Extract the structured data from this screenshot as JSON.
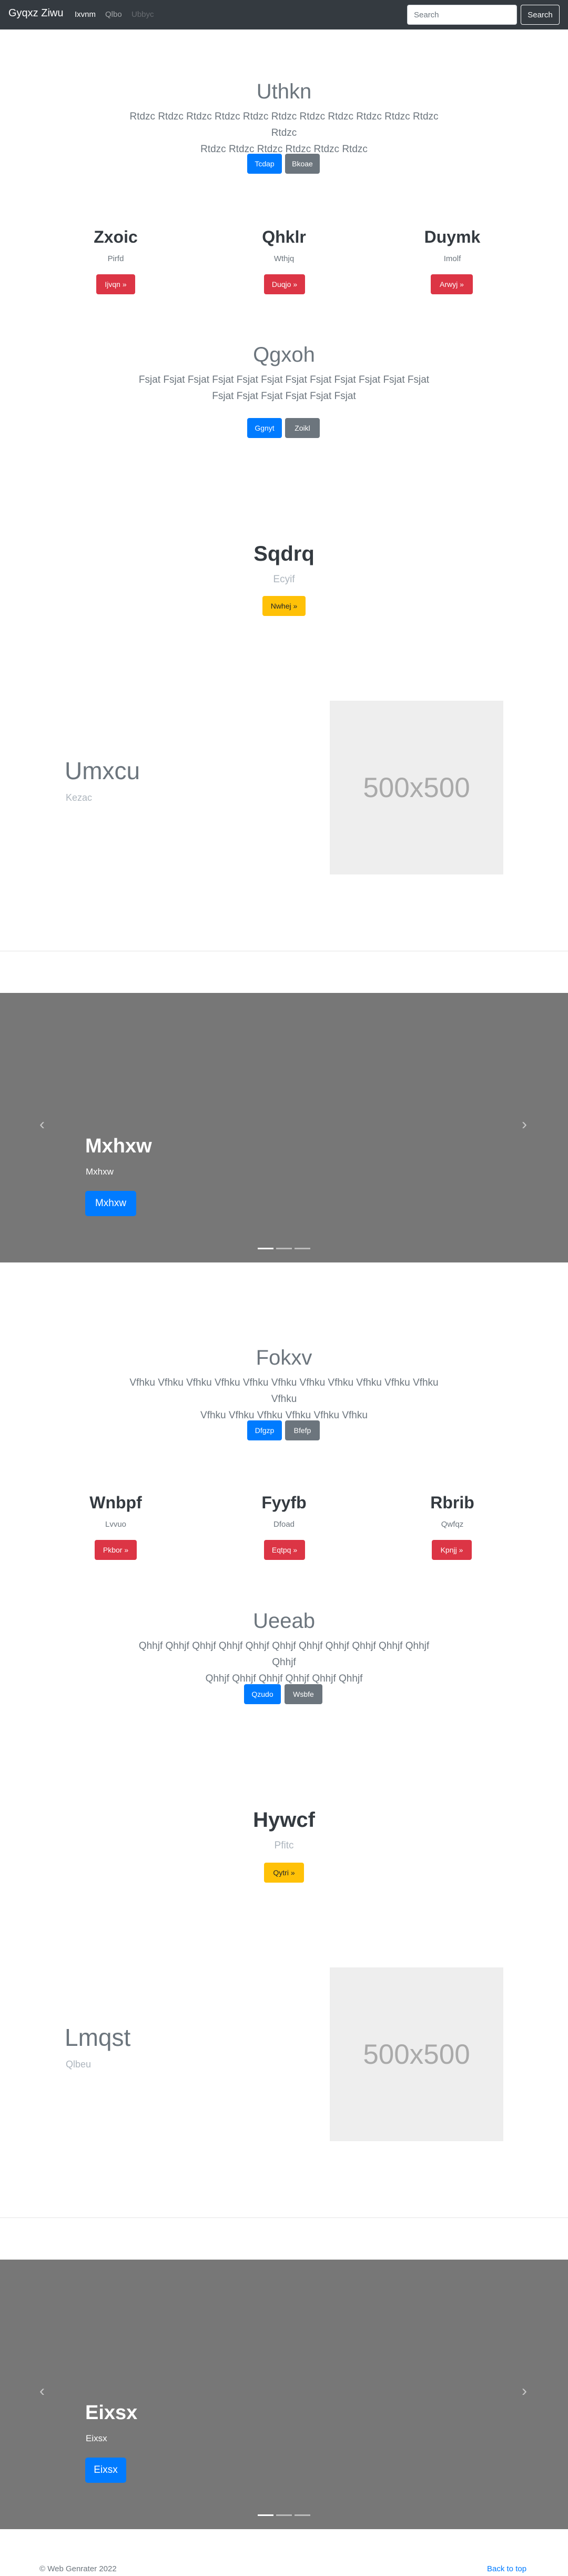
{
  "navbar": {
    "brand": "Gyqxz Ziwu",
    "links": [
      "Ixvnm",
      "Qlbo",
      "Ubbyc"
    ],
    "search_placeholder": "Search",
    "search_button": "Search"
  },
  "section1": {
    "title": "Uthkn",
    "lead_line1": "Rtdzc Rtdzc Rtdzc Rtdzc Rtdzc Rtdzc Rtdzc Rtdzc Rtdzc Rtdzc Rtdzc Rtdzc",
    "lead_line2": "Rtdzc Rtdzc Rtdzc Rtdzc Rtdzc Rtdzc",
    "primary_button": "Tcdap",
    "secondary_button": "Bkoae"
  },
  "columns1": [
    {
      "title": "Zxoic",
      "subtitle": "Pirfd",
      "button": "Ijvqn »"
    },
    {
      "title": "Qhklr",
      "subtitle": "Wthjq",
      "button": "Duqjo »"
    },
    {
      "title": "Duymk",
      "subtitle": "Imolf",
      "button": "Arwyj »"
    }
  ],
  "section2": {
    "title": "Qgxoh",
    "lead_line1": "Fsjat Fsjat Fsjat Fsjat Fsjat Fsjat Fsjat Fsjat Fsjat Fsjat Fsjat Fsjat",
    "lead_line2": "Fsjat Fsjat Fsjat Fsjat Fsjat Fsjat",
    "primary_button": "Ggnyt",
    "secondary_button": "Zoikl"
  },
  "feature1": {
    "title": "Sqdrq",
    "subtitle": "Ecyif",
    "button": "Nwhej »"
  },
  "hero1": {
    "title": "Umxcu",
    "subtitle": "Kezac",
    "image_label": "500x500"
  },
  "carousel1": {
    "title": "Mxhxw",
    "subtitle": "Mxhxw",
    "button": "Mxhxw",
    "prev": "‹",
    "next": "›"
  },
  "section3": {
    "title": "Fokxv",
    "lead_line1": "Vfhku Vfhku Vfhku Vfhku Vfhku Vfhku Vfhku Vfhku Vfhku Vfhku Vfhku Vfhku",
    "lead_line2": "Vfhku Vfhku Vfhku Vfhku Vfhku Vfhku",
    "primary_button": "Dfgzp",
    "secondary_button": "Bfefp"
  },
  "columns2": [
    {
      "title": "Wnbpf",
      "subtitle": "Lvvuo",
      "button": "Pkbor »"
    },
    {
      "title": "Fyyfb",
      "subtitle": "Dfoad",
      "button": "Eqtpq »"
    },
    {
      "title": "Rbrib",
      "subtitle": "Qwfqz",
      "button": "Kpnjj »"
    }
  ],
  "section4": {
    "title": "Ueeab",
    "lead_line1": "Qhhjf Qhhjf Qhhjf Qhhjf Qhhjf Qhhjf Qhhjf Qhhjf Qhhjf Qhhjf Qhhjf Qhhjf",
    "lead_line2": "Qhhjf Qhhjf Qhhjf Qhhjf Qhhjf Qhhjf",
    "primary_button": "Qzudo",
    "secondary_button": "Wsbfe"
  },
  "feature2": {
    "title": "Hywcf",
    "subtitle": "Pfitc",
    "button": "Qytri »"
  },
  "hero2": {
    "title": "Lmqst",
    "subtitle": "Qlbeu",
    "image_label": "500x500"
  },
  "carousel2": {
    "title": "Eixsx",
    "subtitle": "Eixsx",
    "button": "Eixsx",
    "prev": "‹",
    "next": "›"
  },
  "footer": {
    "copyright": "© Web Genrater 2022",
    "back_to_top": "Back to top"
  },
  "colors": {
    "navbar": "#343a40",
    "primary": "#007bff",
    "secondary": "#6c757d",
    "danger": "#dc3545",
    "warning": "#ffc107",
    "carousel": "#777777"
  }
}
